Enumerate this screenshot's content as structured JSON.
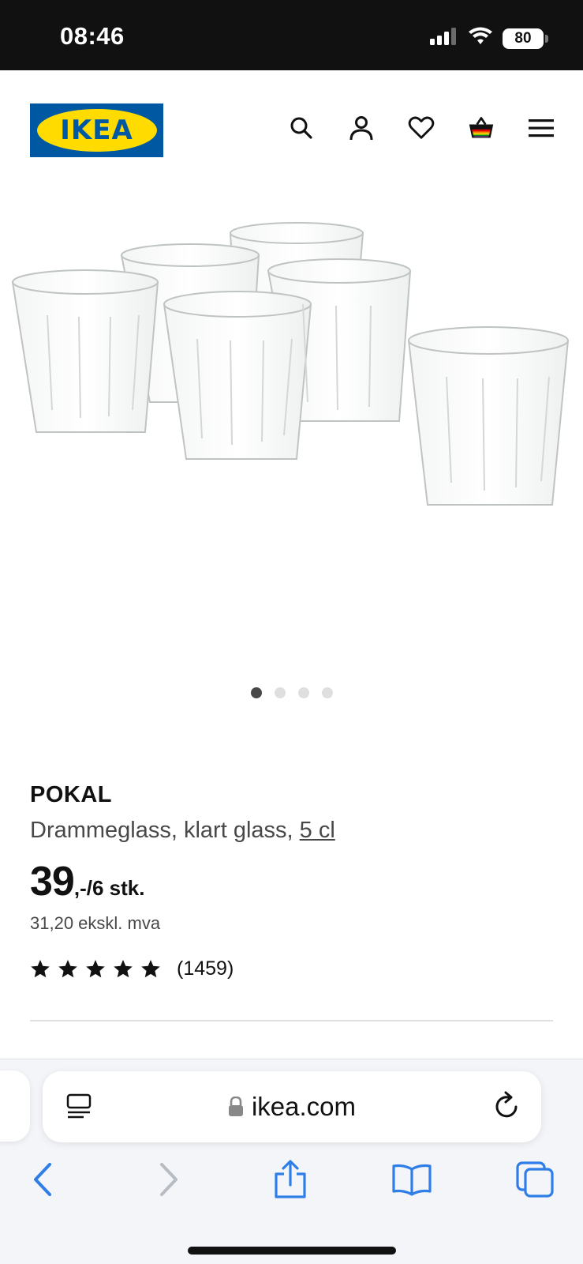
{
  "status_bar": {
    "time": "08:46",
    "battery": "80"
  },
  "header": {
    "logo_text": "IKEA"
  },
  "gallery": {
    "slides": 4,
    "active_slide": 1
  },
  "product": {
    "name": "POKAL",
    "description": "Drammeglass, klart glass, ",
    "size_link": "5 cl",
    "price_integer": "39",
    "price_suffix": ",-/6 stk.",
    "price_ex_vat": "31,20 ekskl. mva",
    "rating": 5,
    "rating_count": "(1459)"
  },
  "browser": {
    "url": "ikea.com"
  },
  "colors": {
    "ikea_blue": "#0058a3",
    "ikea_yellow": "#ffdb00",
    "safari_blue": "#2f7ee7"
  }
}
